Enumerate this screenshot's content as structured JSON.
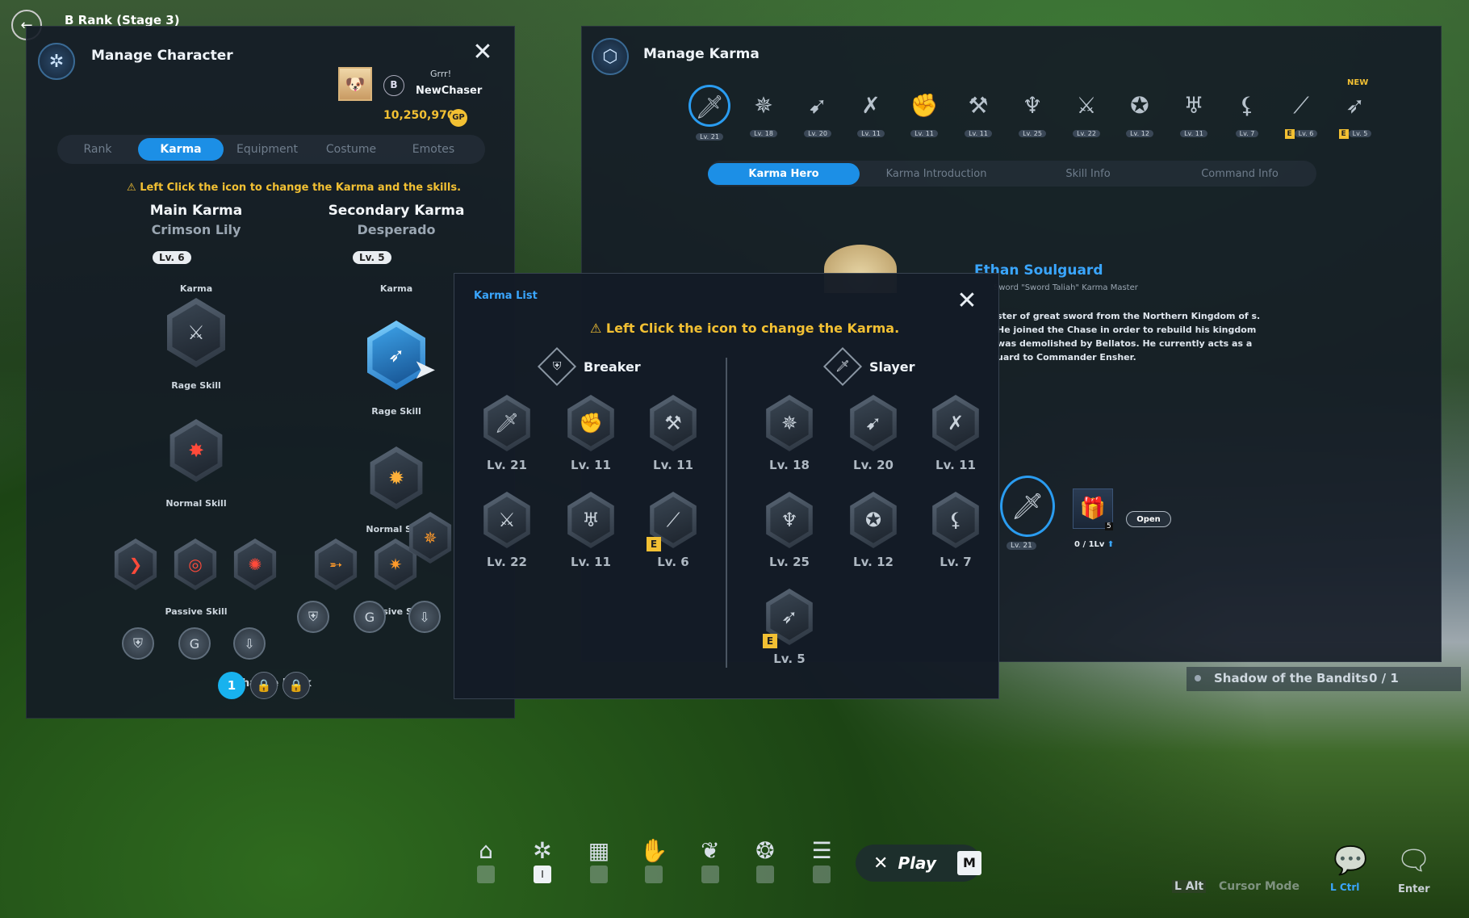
{
  "hud": {
    "rank_label": "B Rank (Stage 3)"
  },
  "manage_character": {
    "title": "Manage Character",
    "player": {
      "status": "Grrr!",
      "name": "NewChaser",
      "gp": "10,250,970",
      "gp_label": "GP",
      "rank_letter": "B"
    },
    "tabs": [
      "Rank",
      "Karma",
      "Equipment",
      "Costume",
      "Emotes"
    ],
    "active_tab": "Karma",
    "warning": "Left Click the icon to change the Karma and the skills.",
    "main": {
      "heading": "Main Karma",
      "name": "Crimson Lily",
      "level": "Lv. 6"
    },
    "secondary": {
      "heading": "Secondary Karma",
      "name": "Desperado",
      "level": "Lv. 5"
    },
    "labels": {
      "karma": "Karma",
      "rage": "Rage Skill",
      "normal": "Normal Skill",
      "passive": "Passive Skill"
    },
    "change_deck": "Change Deck",
    "deck_active": "1"
  },
  "manage_karma": {
    "title": "Manage Karma",
    "new_badge": "NEW",
    "karma_bar": [
      {
        "lv": "Lv. 21",
        "icon": "sword-icon"
      },
      {
        "lv": "Lv. 18",
        "icon": "star-staff-icon"
      },
      {
        "lv": "Lv. 20",
        "icon": "bow-icon"
      },
      {
        "lv": "Lv. 11",
        "icon": "crossed-blades-icon"
      },
      {
        "lv": "Lv. 11",
        "icon": "gauntlet-icon"
      },
      {
        "lv": "Lv. 11",
        "icon": "hammer-icon"
      },
      {
        "lv": "Lv. 25",
        "icon": "spear-icon"
      },
      {
        "lv": "Lv. 22",
        "icon": "axe-icon"
      },
      {
        "lv": "Lv. 12",
        "icon": "chakram-icon"
      },
      {
        "lv": "Lv. 11",
        "icon": "wings-icon"
      },
      {
        "lv": "Lv. 7",
        "icon": "dagger-icon"
      },
      {
        "lv": "Lv. 6",
        "icon": "blade-icon",
        "e": "E"
      },
      {
        "lv": "Lv. 5",
        "icon": "gun-icon",
        "e": "E"
      }
    ],
    "tabs": [
      "Karma Hero",
      "Karma Introduction",
      "Skill Info",
      "Command Info"
    ],
    "active_tab": "Karma Hero",
    "hero": {
      "name": "Ethan Soulguard",
      "subtitle": "Sword \"Sword Taliah\" Karma Master",
      "desc": "ster of great sword from the Northern Kingdom of s. He joined the Chase in order to rebuild his kingdom was demolished by Bellatos. He currently acts as a uard to Commander Ensher."
    },
    "hero_level": "Lv. 21",
    "chest_count": "5",
    "chest_progress": "0 / 1Lv",
    "open_button": "Open"
  },
  "quest": {
    "name": "Shadow of the Bandits",
    "progress": "0 / 1"
  },
  "karma_list": {
    "title": "Karma List",
    "warning": "Left Click the icon to change the Karma.",
    "breaker": {
      "label": "Breaker",
      "items": [
        {
          "lv": "Lv. 21",
          "icon": "sword-icon"
        },
        {
          "lv": "Lv. 11",
          "icon": "gauntlet-icon"
        },
        {
          "lv": "Lv. 11",
          "icon": "hammer-icon"
        },
        {
          "lv": "Lv. 22",
          "icon": "axe-icon"
        },
        {
          "lv": "Lv. 11",
          "icon": "wings-icon"
        },
        {
          "lv": "Lv. 6",
          "icon": "blade-icon",
          "e": "E"
        }
      ]
    },
    "slayer": {
      "label": "Slayer",
      "items": [
        {
          "lv": "Lv. 18",
          "icon": "star-staff-icon"
        },
        {
          "lv": "Lv. 20",
          "icon": "bow-icon"
        },
        {
          "lv": "Lv. 11",
          "icon": "crossed-blades-icon"
        },
        {
          "lv": "Lv. 25",
          "icon": "spear-icon"
        },
        {
          "lv": "Lv. 12",
          "icon": "chakram-icon"
        },
        {
          "lv": "Lv. 7",
          "icon": "dagger-icon"
        },
        {
          "lv": "Lv. 5",
          "icon": "gun-icon",
          "e": "E"
        }
      ]
    }
  },
  "bottom_bar": {
    "play_label": "Play",
    "play_key": "M",
    "char_key": "I",
    "right_keys": {
      "alt": "L Alt",
      "cursor": "Cursor Mode",
      "ctrl": "L Ctrl",
      "enter": "Enter"
    }
  }
}
